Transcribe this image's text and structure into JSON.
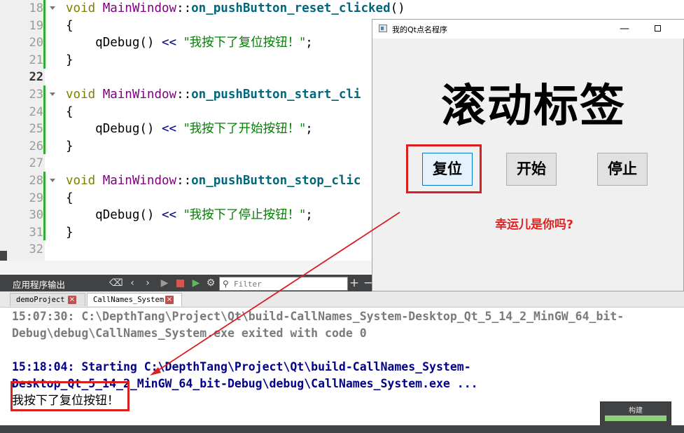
{
  "editor": {
    "lines": [
      {
        "num": "18",
        "fold": true,
        "kind": "sig",
        "cls": "MainWindow",
        "func": "on_pushButton_reset_clicked",
        "tail": "()"
      },
      {
        "num": "19",
        "fold": false,
        "kind": "brace",
        "text": "{"
      },
      {
        "num": "20",
        "fold": false,
        "kind": "debug",
        "call": "qDebug()",
        "op": "<<",
        "str": "\"我按下了复位按钮！\"",
        "end": ";"
      },
      {
        "num": "21",
        "fold": false,
        "kind": "brace",
        "text": "}"
      },
      {
        "num": "22",
        "fold": false,
        "kind": "empty",
        "current": true
      },
      {
        "num": "23",
        "fold": true,
        "kind": "sig",
        "cls": "MainWindow",
        "func": "on_pushButton_start_cli",
        "tail": ""
      },
      {
        "num": "24",
        "fold": false,
        "kind": "brace",
        "text": "{"
      },
      {
        "num": "25",
        "fold": false,
        "kind": "debug",
        "call": "qDebug()",
        "op": "<<",
        "str": "\"我按下了开始按钮！\"",
        "end": ";"
      },
      {
        "num": "26",
        "fold": false,
        "kind": "brace",
        "text": "}"
      },
      {
        "num": "27",
        "fold": false,
        "kind": "empty"
      },
      {
        "num": "28",
        "fold": true,
        "kind": "sig",
        "cls": "MainWindow",
        "func": "on_pushButton_stop_clic",
        "tail": ""
      },
      {
        "num": "29",
        "fold": false,
        "kind": "brace",
        "text": "{"
      },
      {
        "num": "30",
        "fold": false,
        "kind": "debug",
        "call": "qDebug()",
        "op": "<<",
        "str": "\"我按下了停止按钮！\"",
        "end": ";"
      },
      {
        "num": "31",
        "fold": false,
        "kind": "brace",
        "text": "}"
      },
      {
        "num": "32",
        "fold": false,
        "kind": "empty"
      }
    ],
    "keyword_void": "void",
    "scope_op": "::"
  },
  "output_pane": {
    "title": "应用程序输出",
    "filter_placeholder": "Filter",
    "tabs": [
      {
        "label": "demoProject",
        "active": false
      },
      {
        "label": "CallNames_System",
        "active": true
      }
    ],
    "lines": [
      {
        "text": "15:07:30: C:\\DepthTang\\Project\\Qt\\build-CallNames_System-Desktop_Qt_5_14_2_MinGW_64_bit-",
        "style": "gray"
      },
      {
        "text": "Debug\\debug\\CallNames_System.exe exited with code 0",
        "style": "gray"
      },
      {
        "text": "",
        "style": "gray"
      },
      {
        "text": "15:18:04: Starting C:\\DepthTang\\Project\\Qt\\build-CallNames_System-",
        "style": "blue"
      },
      {
        "text": "Desktop_Qt_5_14_2_MinGW_64_bit-Debug\\debug\\CallNames_System.exe ...",
        "style": "blue"
      },
      {
        "text": "我按下了复位按钮！",
        "style": "cn"
      }
    ]
  },
  "build": {
    "label": "构建",
    "progress": 1.0
  },
  "qt_window": {
    "title": "我的Qt点名程序",
    "min_glyph": "—",
    "big_label": "滚动标签",
    "buttons": {
      "reset": "复位",
      "start": "开始",
      "stop": "停止"
    },
    "sub_label": "幸运儿是你吗?"
  },
  "colors": {
    "highlight": "#d9201f",
    "sub_label": "#e41f1f",
    "focus_border": "#0078d7"
  }
}
